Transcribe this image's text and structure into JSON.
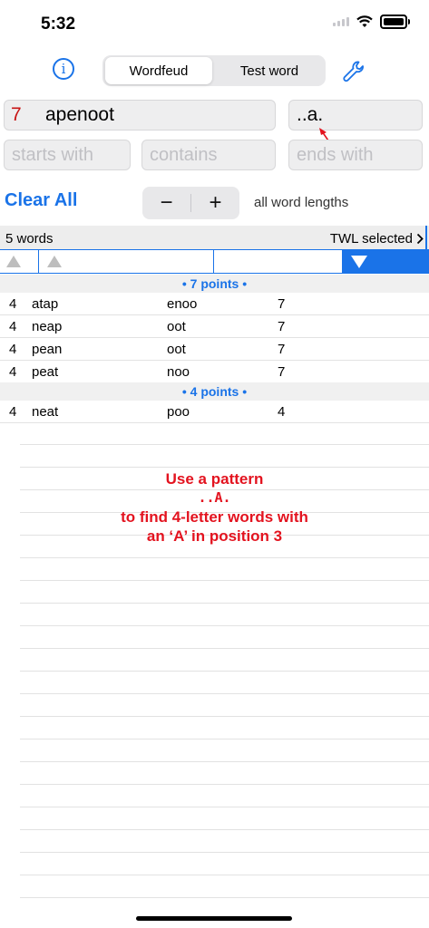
{
  "status": {
    "time": "5:32"
  },
  "header": {
    "tabs": [
      {
        "label": "Wordfeud",
        "active": true
      },
      {
        "label": "Test word",
        "active": false
      }
    ]
  },
  "inputs": {
    "letter_count": "7",
    "letters": "apenoot",
    "pattern": "..a.",
    "starts_with_placeholder": "starts with",
    "contains_placeholder": "contains",
    "ends_with_placeholder": "ends with"
  },
  "controls": {
    "clear_all": "Clear All",
    "minus": "−",
    "plus": "+",
    "length_label": "all word lengths"
  },
  "results": {
    "count_label": "5 words",
    "dictionary_label": "TWL selected",
    "sections": [
      {
        "header": "• 7 points •",
        "rows": [
          {
            "len": "4",
            "word": "atap",
            "remaining": "enoo",
            "points": "7"
          },
          {
            "len": "4",
            "word": "neap",
            "remaining": "oot",
            "points": "7"
          },
          {
            "len": "4",
            "word": "pean",
            "remaining": "oot",
            "points": "7"
          },
          {
            "len": "4",
            "word": "peat",
            "remaining": "noo",
            "points": "7"
          }
        ]
      },
      {
        "header": "• 4 points •",
        "rows": [
          {
            "len": "4",
            "word": "neat",
            "remaining": "poo",
            "points": "4"
          }
        ]
      }
    ]
  },
  "annotation": {
    "line1": "Use a pattern",
    "line2": "..A.",
    "line3": "to find 4-letter words with",
    "line4": "an ‘A’ in position 3"
  },
  "colors": {
    "accent": "#1a73e8",
    "annotation": "#e3131f",
    "count": "#c81414"
  }
}
